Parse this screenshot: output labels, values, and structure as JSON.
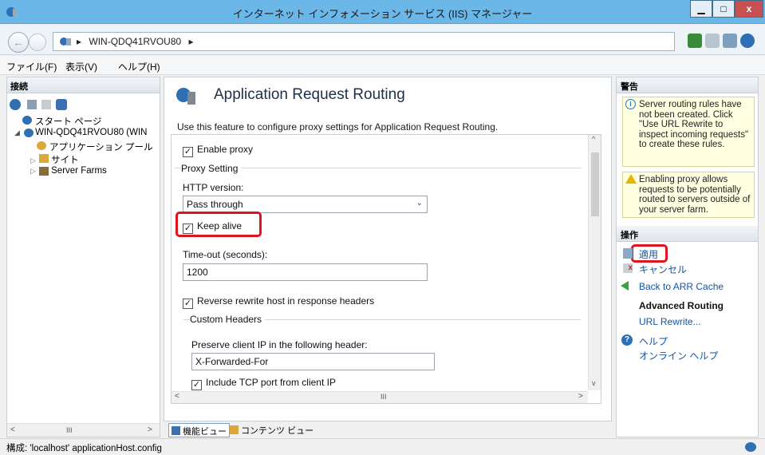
{
  "window": {
    "title": "インターネット インフォメーション サービス (IIS) マネージャー",
    "min_glyph": "▁",
    "max_glyph": "□",
    "close_glyph": "x"
  },
  "address": {
    "back_glyph": "←",
    "path": "WIN-QDQ41RVOU80",
    "arrow": "▸",
    "arrow2": "▸"
  },
  "menu": [
    "ファイル(F)",
    "表示(V)",
    "ヘルプ(H)"
  ],
  "connections": {
    "header": "接続",
    "tree": [
      {
        "label": "スタート ページ"
      },
      {
        "label": "WIN-QDQ41RVOU80 (WIN"
      },
      {
        "label": "アプリケーション プール"
      },
      {
        "label": "サイト"
      },
      {
        "label": "Server Farms"
      }
    ],
    "scroll_mid": "III"
  },
  "feature": {
    "title": "Application Request Routing",
    "description": "Use this feature to configure proxy settings for Application Request Routing.",
    "enable_proxy": "Enable proxy",
    "proxy_setting": "Proxy Setting",
    "http_version_label": "HTTP version:",
    "http_version_value": "Pass through",
    "keep_alive": "Keep alive",
    "timeout_label": "Time-out (seconds):",
    "timeout_value": "1200",
    "reverse_rewrite": "Reverse rewrite host in response headers",
    "custom_headers": "Custom Headers",
    "preserve_ip_label": "Preserve client IP in the following header:",
    "preserve_ip_value": "X-Forwarded-For",
    "include_port": "Include TCP port from client IP",
    "scroll_mid": "III"
  },
  "view_tabs": {
    "features": "機能ビュー",
    "content": "コンテンツ ビュー"
  },
  "alerts": {
    "header": "警告",
    "items": [
      "Server routing rules have not been created. Click \"Use URL Rewrite to inspect incoming requests\" to create these rules.",
      "Enabling proxy allows requests to be potentially routed to servers outside of your server farm."
    ]
  },
  "actions": {
    "header": "操作",
    "apply": "適用",
    "cancel": "キャンセル",
    "back_arr": "Back to ARR Cache",
    "advanced_routing": "Advanced Routing",
    "url_rewrite": "URL Rewrite...",
    "help": "ヘルプ",
    "online_help": "オンライン ヘルプ"
  },
  "status": {
    "text": "構成: 'localhost' applicationHost.config"
  },
  "colors": {
    "titlebar": "#6bb7e8",
    "highlight": "#e0141e",
    "link": "#1155aa"
  }
}
